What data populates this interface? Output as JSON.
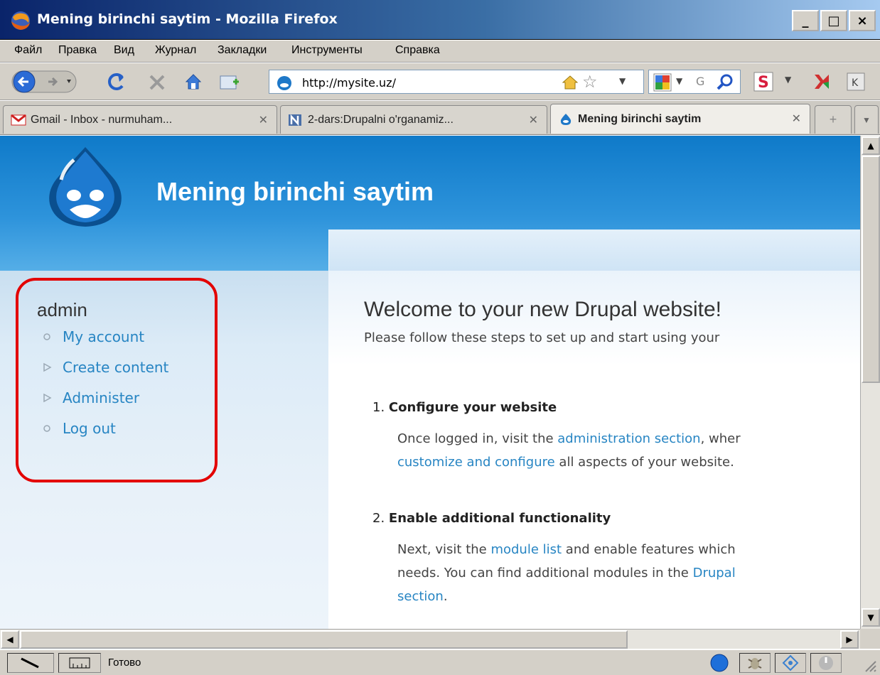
{
  "window": {
    "title": "Mening birinchi saytim - Mozilla Firefox"
  },
  "menubar": [
    "Файл",
    "Правка",
    "Вид",
    "Журнал",
    "Закладки",
    "Инструменты",
    "Справка"
  ],
  "navbar": {
    "url": "http://mysite.uz/"
  },
  "tabs": [
    {
      "label": "Gmail - Inbox - nurmuham...",
      "active": false
    },
    {
      "label": "2-dars:Drupalni o'rganamiz...",
      "active": false
    },
    {
      "label": "Mening birinchi saytim",
      "active": true
    }
  ],
  "site": {
    "title": "Mening birinchi saytim"
  },
  "sidebar": {
    "block_title": "admin",
    "items": [
      {
        "label": "My account"
      },
      {
        "label": "Create content"
      },
      {
        "label": "Administer"
      },
      {
        "label": "Log out"
      }
    ]
  },
  "content": {
    "heading": "Welcome to your new Drupal website!",
    "intro": "Please follow these steps to set up and start using your",
    "steps": [
      {
        "number": "1.",
        "title": "Configure your website",
        "line1_pre": "Once logged in, visit the ",
        "line1_link": "administration section",
        "line1_post": ", wher",
        "line2_link": "customize and configure",
        "line2_post": " all aspects of your website."
      },
      {
        "number": "2.",
        "title": "Enable additional functionality",
        "line1_pre": "Next, visit the ",
        "line1_link": "module list",
        "line1_post": " and enable features which",
        "line2_pre": "needs. You can find additional modules in the ",
        "line2_link": "Drupal",
        "line3_link": "section",
        "line3_post": "."
      }
    ]
  },
  "status": {
    "text": "Готово"
  }
}
